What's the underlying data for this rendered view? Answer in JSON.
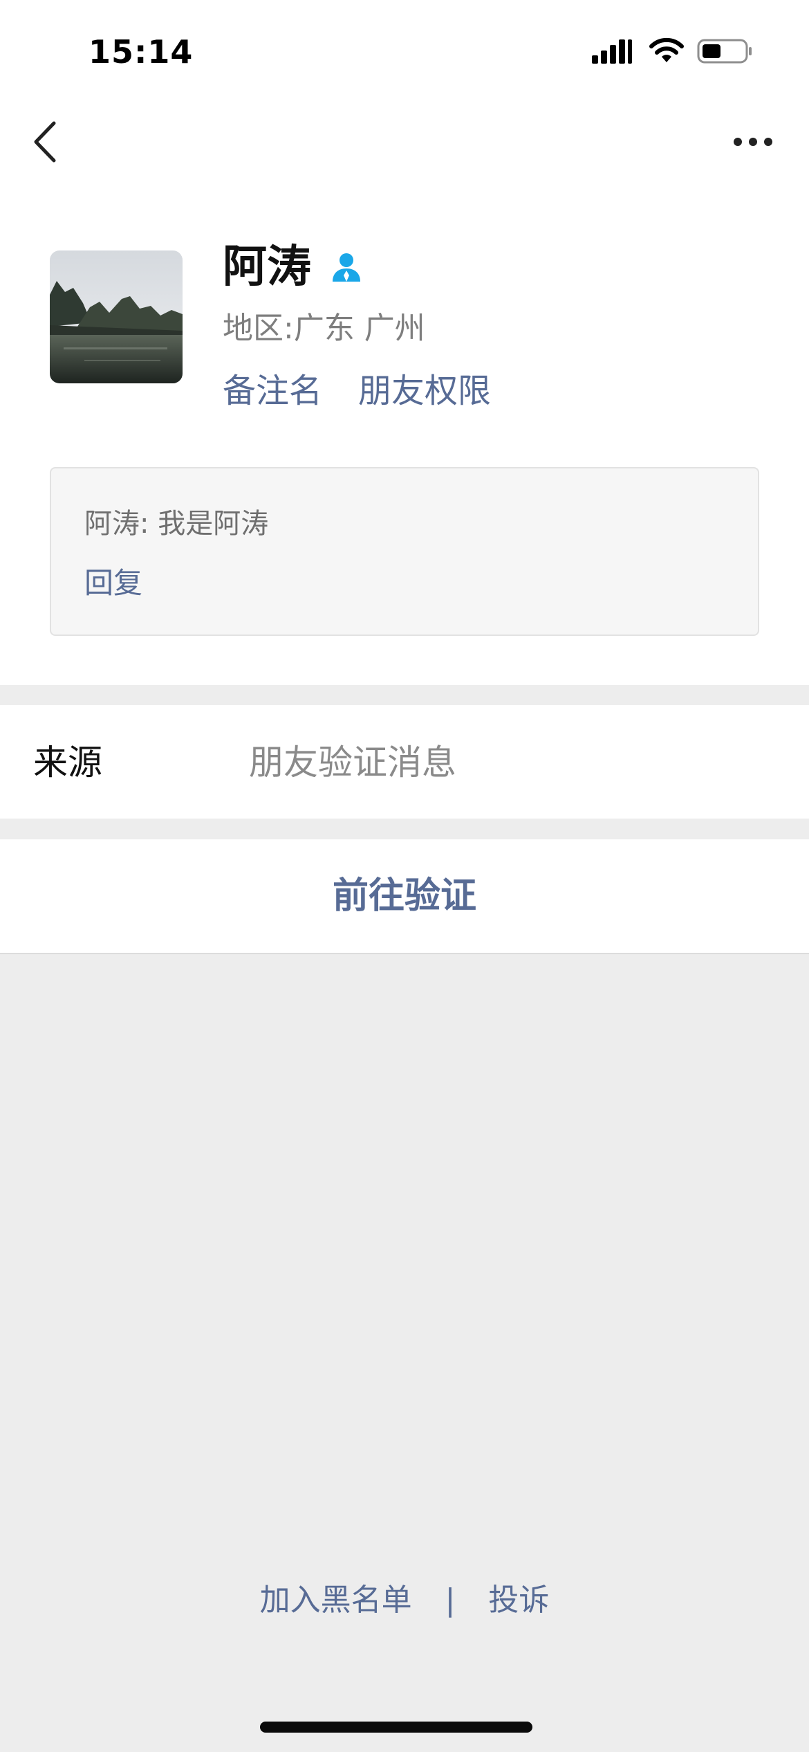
{
  "status_bar": {
    "time": "15:14",
    "icons": [
      "signal-icon",
      "wifi-icon",
      "battery-icon"
    ]
  },
  "nav": {
    "back_icon": "chevron-left-icon",
    "more_icon": "more-icon"
  },
  "profile": {
    "name": "阿涛",
    "contact_icon": "contact-person-icon",
    "region": "地区:广东 广州",
    "remark_link": "备注名",
    "permission_link": "朋友权限"
  },
  "message": {
    "text": "阿涛: 我是阿涛",
    "reply_label": "回复"
  },
  "source": {
    "label": "来源",
    "value": "朋友验证消息"
  },
  "verify": {
    "button_label": "前往验证"
  },
  "footer": {
    "blacklist_label": "加入黑名单",
    "separator": "|",
    "report_label": "投诉"
  },
  "colors": {
    "link": "#576b95",
    "background": "#ededed",
    "contact_icon": "#1aa7e8"
  }
}
